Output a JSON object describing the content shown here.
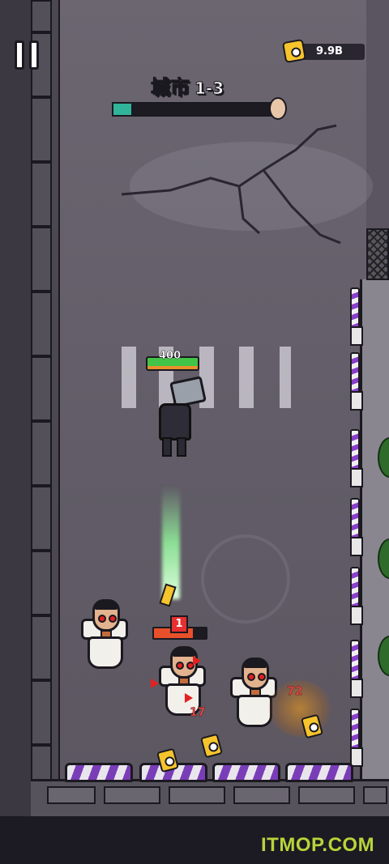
{
  "hud": {
    "currency_icon": "toilet-paper-icon",
    "currency_value": "9.9B",
    "pause_icon": "pause-icon",
    "stage_name": "城市",
    "stage_level": "1-3",
    "stage_progress": 0.08,
    "progress_start_icon": "start-flag-icon",
    "progress_boss_icon": "boss-head-icon"
  },
  "player": {
    "hp": "400",
    "hp_fraction": 1.0
  },
  "enemy_target": {
    "level": "1",
    "hp_fraction": 0.75
  },
  "damage_numbers": [
    "17",
    "72"
  ],
  "watermark": "ITMOP.COM",
  "colors": {
    "hp_green": "#41c447",
    "accent_purple": "#7a3db8",
    "coin_yellow": "#f6c42c",
    "eye_red": "#e32020",
    "watermark_green": "#b7d43a"
  }
}
